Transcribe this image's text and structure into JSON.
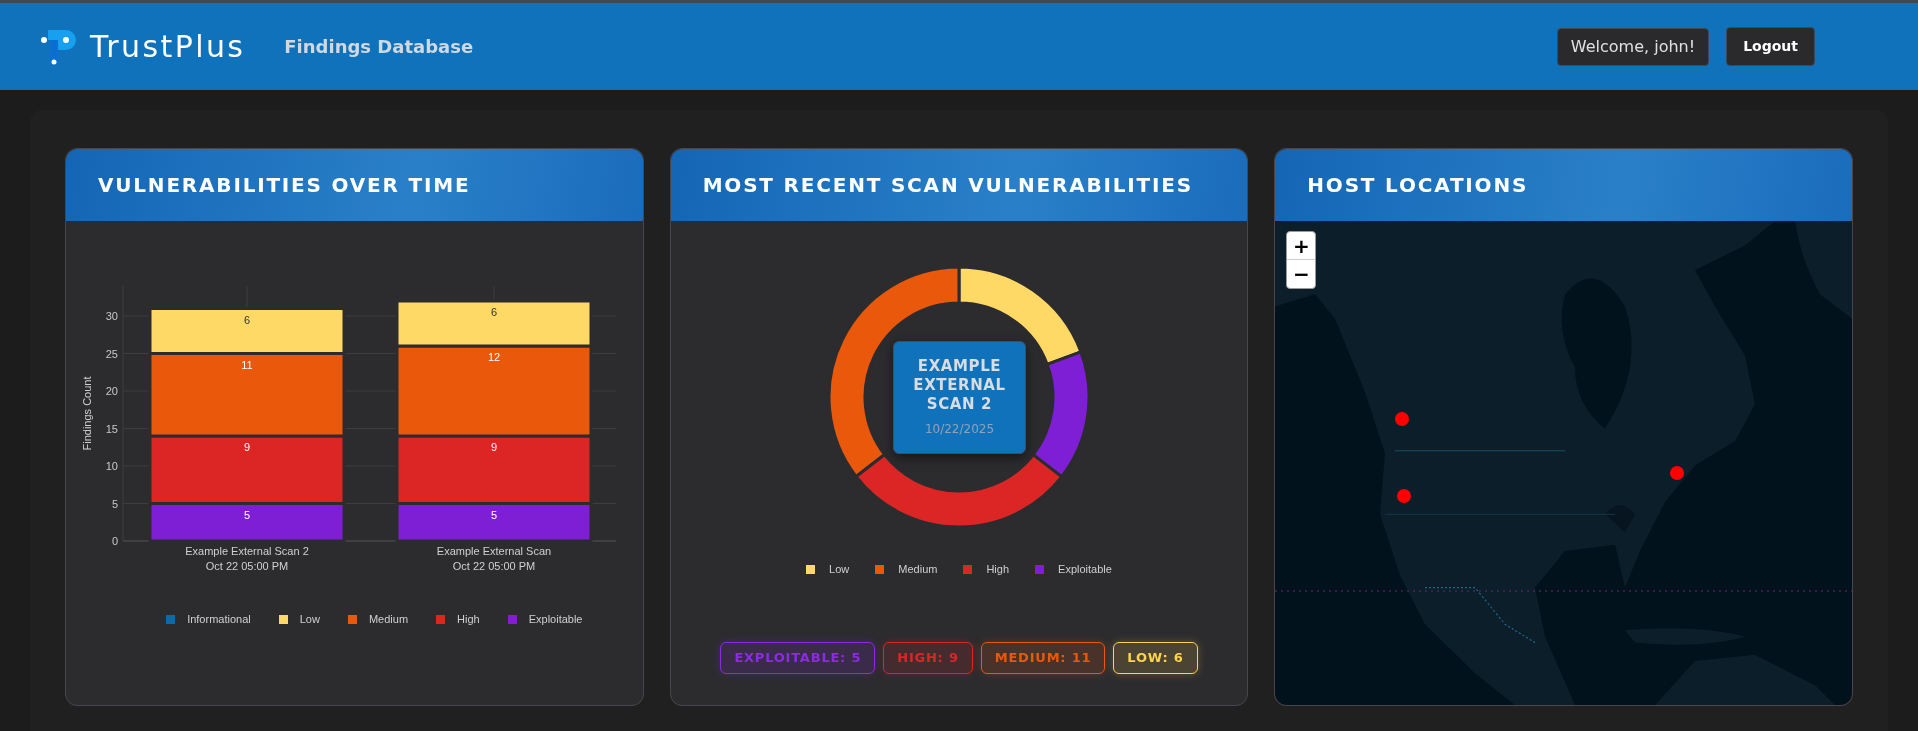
{
  "header": {
    "logo_text": "TrustPlus",
    "nav_title": "Findings Database",
    "welcome": "Welcome, john!",
    "logout": "Logout"
  },
  "vulnerabilities_over_time": {
    "title": "VULNERABILITIES OVER TIME",
    "chart_data": {
      "type": "bar",
      "stacked": true,
      "grid": true,
      "data_labels": true,
      "ylabel": "Findings Count",
      "categories": [
        "Example External Scan 2\nOct 22 05:00 PM",
        "Example External Scan\nOct 22 05:00 PM"
      ],
      "ylim": [
        0,
        34
      ],
      "yticks": [
        0,
        5,
        10,
        15,
        20,
        25,
        30
      ],
      "series": [
        {
          "name": "Informational",
          "color": "#0b6aa8",
          "values": [
            null,
            null
          ]
        },
        {
          "name": "Low",
          "color": "#ffd966",
          "values": [
            6,
            6
          ]
        },
        {
          "name": "Medium",
          "color": "#ea580c",
          "values": [
            11,
            12
          ]
        },
        {
          "name": "High",
          "color": "#dc2626",
          "values": [
            9,
            9
          ]
        },
        {
          "name": "Exploitable",
          "color": "#7e1fd6",
          "values": [
            5,
            5
          ]
        }
      ]
    }
  },
  "recent_scan": {
    "title": "MOST RECENT SCAN VULNERABILITIES",
    "center_title": "EXAMPLE EXTERNAL SCAN 2",
    "center_date": "10/22/2025",
    "chart_data": {
      "type": "donut",
      "categories": [
        "Low",
        "Medium",
        "High",
        "Exploitable"
      ],
      "values": [
        19.36,
        35.48,
        29.03,
        16.13
      ],
      "colors": [
        "#ffd966",
        "#ea580c",
        "#dc2626",
        "#7e1fd6"
      ]
    },
    "badges": [
      {
        "text": "EXPLOITABLE: 5",
        "color": "#8b2be2"
      },
      {
        "text": "HIGH: 9",
        "color": "#dc2626"
      },
      {
        "text": "MEDIUM: 11",
        "color": "#ea580c"
      },
      {
        "text": "LOW: 6",
        "color": "#fcd34d"
      }
    ]
  },
  "host_locations": {
    "title": "HOST LOCATIONS",
    "zoom_in": "+",
    "zoom_out": "−"
  }
}
